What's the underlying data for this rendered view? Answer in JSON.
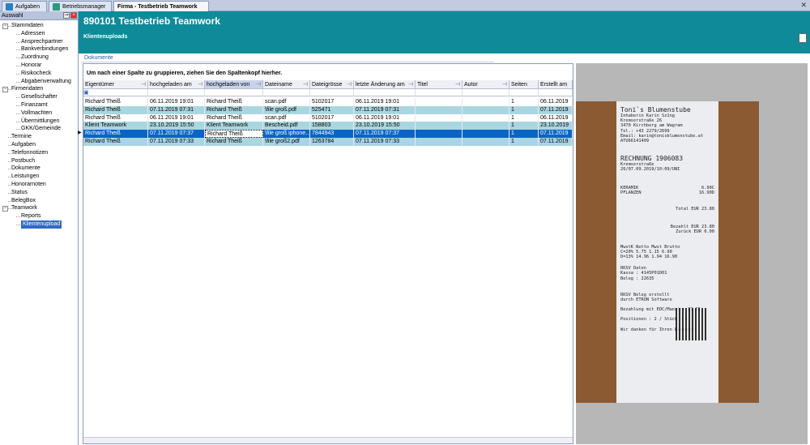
{
  "tabs": [
    {
      "label": "Aufgaben",
      "icon": "tasks-icon"
    },
    {
      "label": "Betriebsmanager",
      "icon": "person-icon"
    },
    {
      "label": "Firma - Testbetrieb Teamwork",
      "icon": ""
    }
  ],
  "sidebar": {
    "title": "Auswahl",
    "tree": [
      {
        "label": "Stammdaten",
        "level": 0,
        "expander": "−"
      },
      {
        "label": "Adressen",
        "level": 1
      },
      {
        "label": "Ansprechpartner",
        "level": 1
      },
      {
        "label": "Bankverbindungen",
        "level": 1
      },
      {
        "label": "Zuordnung",
        "level": 1
      },
      {
        "label": "Honorar",
        "level": 1
      },
      {
        "label": "Risikocheck",
        "level": 1
      },
      {
        "label": "Abgabenverwaltung",
        "level": 1
      },
      {
        "label": "Firmendaten",
        "level": 0,
        "expander": "−"
      },
      {
        "label": "Gesellschafter",
        "level": 1
      },
      {
        "label": "Finanzamt",
        "level": 1
      },
      {
        "label": "Vollmachten",
        "level": 1
      },
      {
        "label": "Übermittlungen",
        "level": 1
      },
      {
        "label": "GKK/Gemeinde",
        "level": 1
      },
      {
        "label": "Termine",
        "level": 0
      },
      {
        "label": "Aufgaben",
        "level": 0
      },
      {
        "label": "Telefonnotizen",
        "level": 0
      },
      {
        "label": "Postbuch",
        "level": 0
      },
      {
        "label": "Dokumente",
        "level": 0
      },
      {
        "label": "Leistungen",
        "level": 0
      },
      {
        "label": "Honorarnoten",
        "level": 0
      },
      {
        "label": "Status",
        "level": 0
      },
      {
        "label": "BelegBox",
        "level": 0
      },
      {
        "label": "Teamwork",
        "level": 0,
        "expander": "−"
      },
      {
        "label": "Reports",
        "level": 1
      },
      {
        "label": "Klientenupload",
        "level": 1,
        "selected": true
      }
    ]
  },
  "header": {
    "title": "890101 Testbetrieb Teamwork",
    "subtitle": "Klientenuploads"
  },
  "breadcrumb": "Dokumente",
  "grid": {
    "group_hint": "Um nach einer Spalte zu gruppieren, ziehen Sie den Spaltenkopf hierher.",
    "columns": [
      "Eigentümer",
      "hochgeladen am",
      "hochgeladen von",
      "Dateiname",
      "Dateigrösse",
      "letzte Änderung am",
      "Titel",
      "Autor",
      "Seiten",
      "Erstellt am"
    ],
    "rows": [
      [
        "Richard Theiß",
        "06.11.2019 19:01",
        "Richard Theiß",
        "scan.pdf",
        "5102017",
        "06.11.2019 19:01",
        "",
        "",
        "1",
        "06.11.2019"
      ],
      [
        "Richard Theiß",
        "07.11.2019 07:31",
        "Richard Theiß",
        "\\file groß.pdf",
        "525471",
        "07.11.2019 07:31",
        "",
        "",
        "1",
        "07.11.2019"
      ],
      [
        "Richard Theiß",
        "06.11.2019 19:01",
        "Richard Theiß",
        "scan.pdf",
        "5102017",
        "06.11.2019 19:01",
        "",
        "",
        "1",
        "06.11.2019"
      ],
      [
        "Klient Teamwork",
        "23.10.2019 15:50",
        "Klient Teamwork",
        "Bescheid.pdf",
        "158803",
        "23.10.2019 15:50",
        "",
        "",
        "1",
        "23.10.2019"
      ],
      [
        "Richard Theiß",
        "07.11.2019 07:37",
        "Richard Theiß",
        "\\file groß iphone...",
        "7844943",
        "07.11.2019 07:37",
        "",
        "",
        "1",
        "07.11.2019"
      ],
      [
        "Richard Theiß",
        "07.11.2019 07:33",
        "Richard Theiß",
        "\\file groß2.pdf",
        "1263784",
        "07.11.2019 07:33",
        "",
        "",
        "1",
        "07.11.2019"
      ]
    ],
    "current_row": 4
  },
  "receipt": {
    "shop": "Toni`s Blumenstube",
    "lines": [
      "Inhaberin Karin Sz1ng",
      "Kremserstraße 26",
      "3470 Kirchberg am Wagram",
      "Tel.: +43 2279/2699",
      "Email: karin@tonisblumenstube.at",
      "ATU66141409"
    ],
    "invoice": "RECHNUNG    1906083",
    "invoice_sub": "Kremserstraße 26/07.09.2019/10:09/UNI",
    "items": [
      [
        "KERAMIK",
        "6.90C"
      ],
      [
        "PFLANZEN",
        "16.90D"
      ]
    ],
    "total": "Total EUR       23.80",
    "paid": "Bezahlt EUR     23.80",
    "change": "Zurück EUR       0.00",
    "tax_head": "MwstK   Netto    Mwst   Brutto",
    "tax1": "C=20%    5.75    1.15    6.90",
    "tax2": "D=13%   14.96    1.94   16.90",
    "rksv": "RKSV Daten",
    "kassa": "Kassa : 4145P01D01",
    "beleg": "Beleg : 22635",
    "rksv2": "RKSV Beleg erstellt",
    "rksv3": "durch ETRON Software",
    "pay": "Bezahlung mit EDC/Maestro   23.80",
    "pos": "Positionen :  2 / Stück :   2",
    "thanks": "Wir danken für Ihren Einkauf!"
  }
}
